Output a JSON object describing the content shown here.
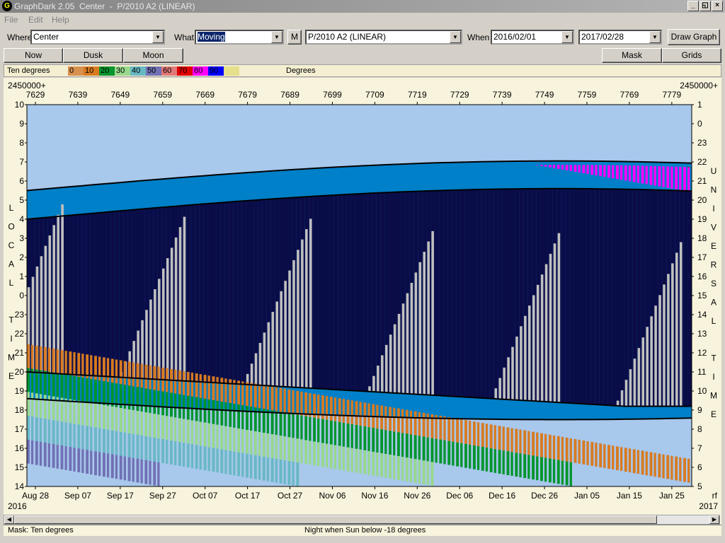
{
  "window": {
    "app_icon": "app-logo-icon",
    "title": "GraphDark 2.05  Center  -  P/2010 A2 (LINEAR)",
    "minimize": "_",
    "restore": "◱",
    "close": "×"
  },
  "menu": {
    "file": "File",
    "edit": "Edit",
    "help": "Help"
  },
  "toolbar": {
    "where_label": "Where",
    "where_value": "Center",
    "what_label": "What",
    "what_value": "Moving",
    "m_button": "M",
    "object_value": "P/2010 A2 (LINEAR)",
    "when_label": "When",
    "start_date": "2016/02/01",
    "end_date": "2017/02/28",
    "draw_button": "Draw Graph"
  },
  "buttons": {
    "now": "Now",
    "dusk": "Dusk",
    "moon": "Moon",
    "mask": "Mask",
    "grids": "Grids"
  },
  "legend": {
    "title": "Ten degrees",
    "unit": "Degrees",
    "items": [
      {
        "label": "0",
        "color": "#d8904f"
      },
      {
        "label": "10",
        "color": "#d87a20"
      },
      {
        "label": "20",
        "color": "#00942c"
      },
      {
        "label": "30",
        "color": "#98d88c"
      },
      {
        "label": "40",
        "color": "#68b8c4"
      },
      {
        "label": "50",
        "color": "#7070b4"
      },
      {
        "label": "60",
        "color": "#e07878"
      },
      {
        "label": "70",
        "color": "#e00000"
      },
      {
        "label": "80",
        "color": "#ff00ff"
      },
      {
        "label": "90",
        "color": "#0000ff"
      },
      {
        "label": "",
        "color": "#e6e08c"
      }
    ]
  },
  "chart_data": {
    "type": "heatmap",
    "jd_prefix_left": "2450000+",
    "jd_prefix_right": "2450000+",
    "jd_ticks": [
      "7629",
      "7639",
      "7649",
      "7659",
      "7669",
      "7679",
      "7689",
      "7699",
      "7709",
      "7719",
      "7729",
      "7739",
      "7749",
      "7759",
      "7769",
      "7779"
    ],
    "date_ticks": [
      "Aug 28",
      "Sep 07",
      "Sep 17",
      "Sep 27",
      "Oct 07",
      "Oct 17",
      "Oct 27",
      "Nov 06",
      "Nov 16",
      "Nov 26",
      "Dec 06",
      "Dec 16",
      "Dec 26",
      "Jan 05",
      "Jan 15",
      "Jan 25"
    ],
    "year_left": "2016",
    "year_right": "2017",
    "right_corner_label": "rf",
    "local_time_ticks": [
      "10",
      "9",
      "8",
      "7",
      "6",
      "5",
      "4",
      "3",
      "2",
      "1",
      "0",
      "23",
      "22",
      "21",
      "20",
      "19",
      "18",
      "17",
      "16",
      "15",
      "14"
    ],
    "universal_time_ticks": [
      "1",
      "0",
      "23",
      "22",
      "21",
      "20",
      "19",
      "18",
      "17",
      "16",
      "15",
      "14",
      "13",
      "12",
      "11",
      "10",
      "9",
      "8",
      "7",
      "6",
      "5"
    ],
    "left_axis_title": "LOCAL TIME",
    "right_axis_title": "UNIVERSAL TIME",
    "colors": {
      "daylight": "#a8c8ec",
      "night": "#0a0c48",
      "twilight": "#0080c8",
      "moonlight": "#c0c0c0",
      "boundary": "#000000"
    },
    "twilight_end_hours": [
      5.5,
      7.05
    ],
    "twilight_start_hours": [
      18.6,
      17.5
    ],
    "night_end_hours": [
      4.0,
      5.6
    ],
    "night_start_hours": [
      20.0,
      18.2
    ],
    "altitude_bands": [
      {
        "label": "10",
        "color": "#d87a20"
      },
      {
        "label": "20",
        "color": "#00942c"
      },
      {
        "label": "30",
        "color": "#98d88c"
      },
      {
        "label": "40",
        "color": "#68b8c4"
      },
      {
        "label": "50",
        "color": "#7070b4"
      },
      {
        "label": "60",
        "color": "#e07878"
      },
      {
        "label": "70",
        "color": "#e00000"
      },
      {
        "label": "80",
        "color": "#ff00ff"
      }
    ]
  },
  "status": {
    "mask": "Mask:  Ten degrees",
    "night": "Night when Sun below -18 degrees"
  }
}
